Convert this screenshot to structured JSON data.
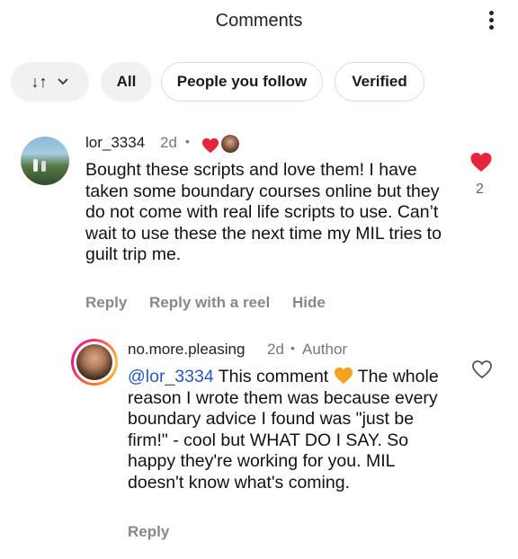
{
  "header": {
    "title": "Comments"
  },
  "filters": {
    "sort_label": "↓↑",
    "all": "All",
    "people_you_follow": "People you follow",
    "verified": "Verified"
  },
  "comments": [
    {
      "username": "lor_3334",
      "time": "2d",
      "separator": "•",
      "text": "Bought these scripts and love them! I have taken some boundary courses online but they do not come with real life scripts to use. Can’t wait to use these the next time my MIL tries to guilt trip me.",
      "like_count": "2",
      "liked": true,
      "actions": [
        "Reply",
        "Reply with a reel",
        "Hide"
      ]
    },
    {
      "username": "no.more.pleasing",
      "time": "2d",
      "separator": "•",
      "author_label": "Author",
      "mention": "@lor_3334",
      "text_a": " This comment ",
      "text_b": " The whole reason I wrote them was because every boundary advice I found was \"just be firm!\" - cool but WHAT DO I SAY. So happy they're working for you. MIL doesn't know what's coming.",
      "liked": false,
      "actions": [
        "Reply"
      ]
    }
  ],
  "colors": {
    "like_red": "#e8243c",
    "mention_blue": "#2b57c6",
    "orange_heart": "#f5a31c"
  }
}
